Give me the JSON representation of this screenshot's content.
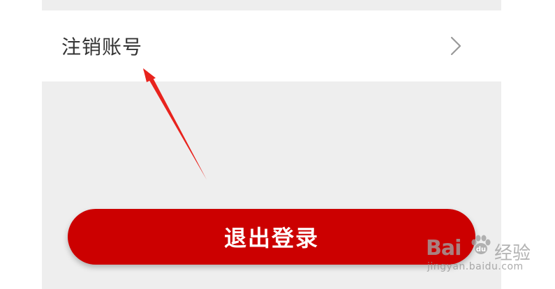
{
  "settings": {
    "deactivate_account_label": "注销账号"
  },
  "actions": {
    "logout_label": "退出登录"
  },
  "colors": {
    "accent": "#cc0000",
    "background": "#eeeeee",
    "row_background": "#ffffff",
    "annotation_arrow": "#e8231d"
  },
  "icons": {
    "row_chevron": "chevron-right-icon"
  },
  "watermark": {
    "brand": "Bai",
    "brand_suffix": "经验",
    "url": "jingyan.baidu.com"
  }
}
